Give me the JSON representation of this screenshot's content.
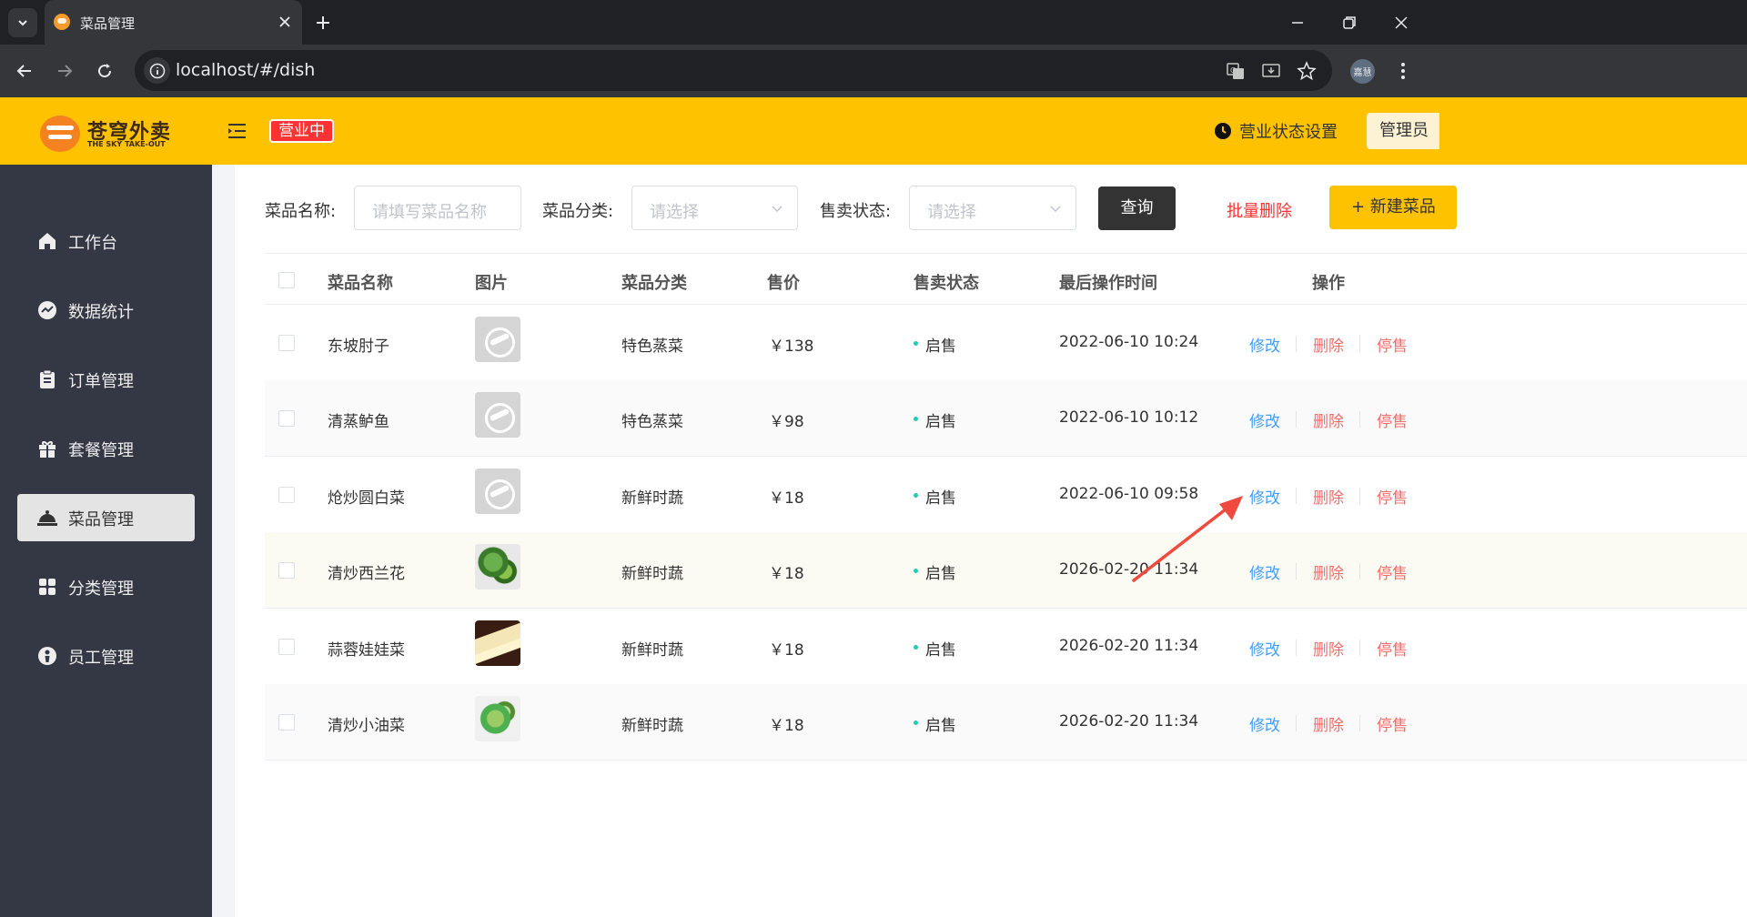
{
  "browser": {
    "tab_title": "菜品管理",
    "url": "localhost/#/dish",
    "profile_label": "嘉慧"
  },
  "header": {
    "logo_cn": "苍穹外卖",
    "logo_en": "THE SKY TAKE-OUT",
    "business_status": "营业中",
    "business_setting": "营业状态设置",
    "admin": "管理员"
  },
  "sidebar": {
    "items": [
      {
        "label": "工作台",
        "icon": "home-icon"
      },
      {
        "label": "数据统计",
        "icon": "chart-icon"
      },
      {
        "label": "订单管理",
        "icon": "clipboard-icon"
      },
      {
        "label": "套餐管理",
        "icon": "gift-icon"
      },
      {
        "label": "菜品管理",
        "icon": "cloche-icon"
      },
      {
        "label": "分类管理",
        "icon": "grid-icon"
      },
      {
        "label": "员工管理",
        "icon": "user-icon"
      }
    ]
  },
  "filters": {
    "name_label": "菜品名称:",
    "name_placeholder": "请填写菜品名称",
    "category_label": "菜品分类:",
    "category_placeholder": "请选择",
    "status_label": "售卖状态:",
    "status_placeholder": "请选择",
    "query": "查询",
    "batch_delete": "批量删除",
    "new_dish": "+ 新建菜品"
  },
  "table": {
    "headers": [
      "菜品名称",
      "图片",
      "菜品分类",
      "售价",
      "售卖状态",
      "最后操作时间",
      "操作"
    ],
    "actions": {
      "edit": "修改",
      "delete": "删除",
      "stop": "停售"
    },
    "rows": [
      {
        "name": "东坡肘子",
        "category": "特色蒸菜",
        "price": "￥138",
        "status": "启售",
        "time": "2022-06-10 10:24",
        "image": "placeholder"
      },
      {
        "name": "清蒸鲈鱼",
        "category": "特色蒸菜",
        "price": "￥98",
        "status": "启售",
        "time": "2022-06-10 10:12",
        "image": "placeholder"
      },
      {
        "name": "炝炒圆白菜",
        "category": "新鲜时蔬",
        "price": "￥18",
        "status": "启售",
        "time": "2022-06-10 09:58",
        "image": "placeholder"
      },
      {
        "name": "清炒西兰花",
        "category": "新鲜时蔬",
        "price": "￥18",
        "status": "启售",
        "time": "2026-02-20 11:34",
        "image": "broccoli"
      },
      {
        "name": "蒜蓉娃娃菜",
        "category": "新鲜时蔬",
        "price": "￥18",
        "status": "启售",
        "time": "2026-02-20 11:34",
        "image": "cabbage"
      },
      {
        "name": "清炒小油菜",
        "category": "新鲜时蔬",
        "price": "￥18",
        "status": "启售",
        "time": "2026-02-20 11:34",
        "image": "greens"
      }
    ]
  },
  "colors": {
    "brand": "#ffc200",
    "sidebar": "#343744",
    "edit": "#419eff",
    "danger": "#f56c6c",
    "status_dot": "#22ccb2",
    "annotation_arrow": "#f04a3e"
  }
}
